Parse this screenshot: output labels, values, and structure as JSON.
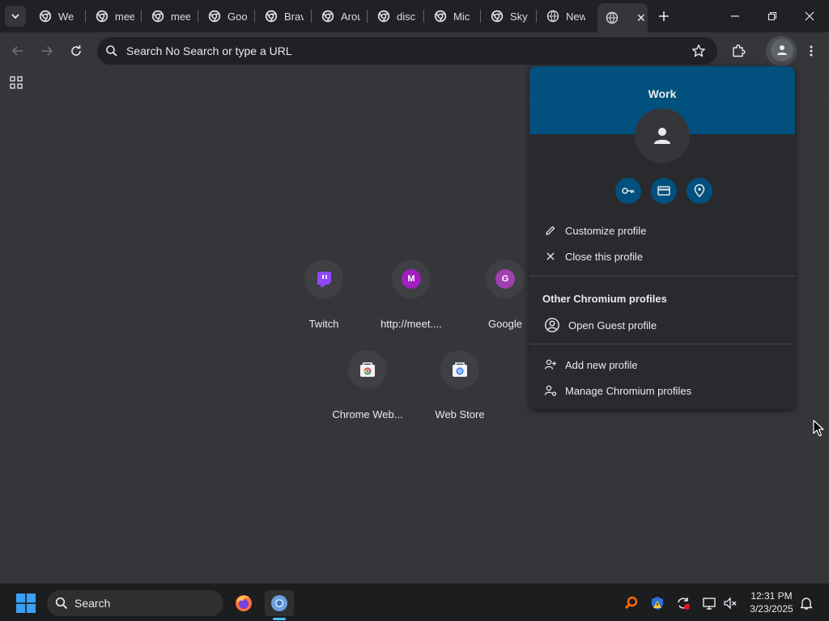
{
  "tabs": [
    {
      "title": "We",
      "icon": "chromium-favicon"
    },
    {
      "title": "mee",
      "icon": "chromium-favicon"
    },
    {
      "title": "mee",
      "icon": "chromium-favicon"
    },
    {
      "title": "Goo",
      "icon": "chromium-favicon"
    },
    {
      "title": "Brav",
      "icon": "chromium-favicon"
    },
    {
      "title": "Arou",
      "icon": "chromium-favicon"
    },
    {
      "title": "disc",
      "icon": "chromium-favicon"
    },
    {
      "title": "Mic",
      "icon": "chromium-favicon"
    },
    {
      "title": "Sky",
      "icon": "chromium-favicon"
    },
    {
      "title": "New",
      "icon": "globe-favicon"
    }
  ],
  "active_tab": {
    "icon": "globe-favicon",
    "close": "✕"
  },
  "omnibox": {
    "text": "Search No Search or type a URL"
  },
  "shortcuts": [
    {
      "label": "Twitch",
      "icon": "twitch-icon"
    },
    {
      "label": "http://meet....",
      "letter": "M",
      "color": "#a020c0"
    },
    {
      "label": "Google",
      "letter": "G",
      "color": "#a040b0"
    },
    {
      "label": "Chrome Web...",
      "icon": "chrome-web-store-icon"
    },
    {
      "label": "Web Store",
      "icon": "chrome-web-store-icon"
    }
  ],
  "profile_menu": {
    "name": "Work",
    "header_color": "#02507d",
    "quick_actions": [
      "passwords-key-icon",
      "payment-card-icon",
      "address-pin-icon"
    ],
    "customize_label": "Customize profile",
    "close_label": "Close this profile",
    "other_section_title": "Other Chromium profiles",
    "guest_label": "Open Guest profile",
    "add_label": "Add new profile",
    "manage_label": "Manage Chromium profiles"
  },
  "taskbar": {
    "search_label": "Search",
    "time": "12:31 PM",
    "date": "3/23/2025"
  }
}
